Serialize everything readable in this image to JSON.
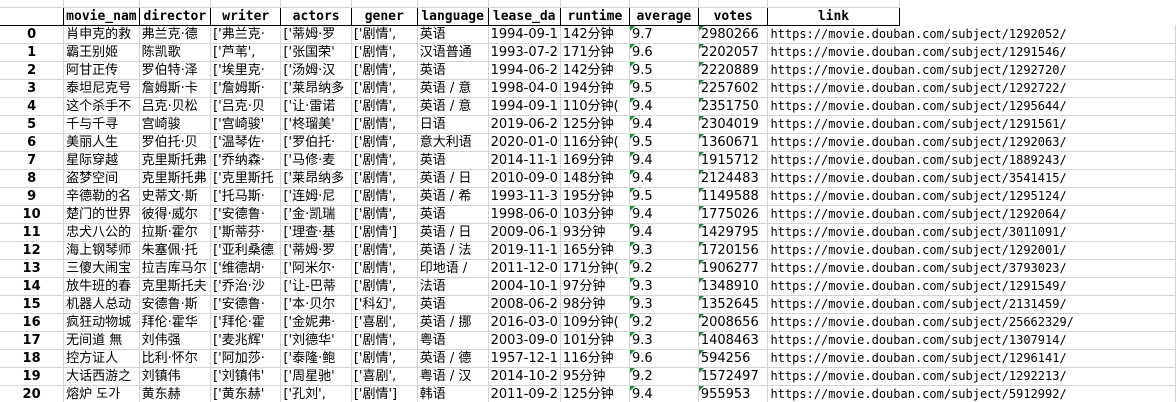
{
  "columns": [
    "",
    "movie_nam",
    "director",
    "writer",
    "actors",
    "gener",
    "language",
    "lease_da",
    "runtime",
    "average",
    "votes",
    "link"
  ],
  "rows": [
    {
      "idx": "0",
      "movie_name": "肖申克的救",
      "director": "弗兰克·德",
      "writer": "['弗兰克·",
      "actors": "['蒂姆·罗",
      "gener": "['剧情',",
      "language": "英语",
      "release": "1994-09-1",
      "runtime": "142分钟",
      "average": "9.7",
      "votes": "2980266",
      "link": "https://movie.douban.com/subject/1292052/"
    },
    {
      "idx": "1",
      "movie_name": "霸王别姬",
      "director": "陈凯歌",
      "writer": "['芦苇',",
      "actors": "['张国荣'",
      "gener": "['剧情',",
      "language": "汉语普通",
      "release": "1993-07-2",
      "runtime": "171分钟",
      "average": "9.6",
      "votes": "2202057",
      "link": "https://movie.douban.com/subject/1291546/"
    },
    {
      "idx": "2",
      "movie_name": "阿甘正传",
      "director": "罗伯特·泽",
      "writer": "['埃里克·",
      "actors": "['汤姆·汉",
      "gener": "['剧情',",
      "language": "英语",
      "release": "1994-06-2",
      "runtime": "142分钟",
      "average": "9.5",
      "votes": "2220889",
      "link": "https://movie.douban.com/subject/1292720/"
    },
    {
      "idx": "3",
      "movie_name": "泰坦尼克号",
      "director": "詹姆斯·卡",
      "writer": "['詹姆斯·",
      "actors": "['莱昂纳多",
      "gener": "['剧情',",
      "language": "英语 / 意",
      "release": "1998-04-0",
      "runtime": "194分钟",
      "average": "9.5",
      "votes": "2257602",
      "link": "https://movie.douban.com/subject/1292722/"
    },
    {
      "idx": "4",
      "movie_name": "这个杀手不",
      "director": "吕克·贝松",
      "writer": "['吕克·贝",
      "actors": "['让·雷诺",
      "gener": "['剧情',",
      "language": "英语 / 意",
      "release": "1994-09-1",
      "runtime": "110分钟(",
      "average": "9.4",
      "votes": "2351750",
      "link": "https://movie.douban.com/subject/1295644/"
    },
    {
      "idx": "5",
      "movie_name": "千与千寻",
      "director": "宫崎骏",
      "writer": "['宫崎骏'",
      "actors": "['柊瑠美'",
      "gener": "['剧情',",
      "language": "日语",
      "release": "2019-06-2",
      "runtime": "125分钟",
      "average": "9.4",
      "votes": "2304019",
      "link": "https://movie.douban.com/subject/1291561/"
    },
    {
      "idx": "6",
      "movie_name": "美丽人生",
      "director": "罗伯托·贝",
      "writer": "['温琴佐·",
      "actors": "['罗伯托·",
      "gener": "['剧情',",
      "language": "意大利语",
      "release": "2020-01-0",
      "runtime": "116分钟(",
      "average": "9.5",
      "votes": "1360671",
      "link": "https://movie.douban.com/subject/1292063/"
    },
    {
      "idx": "7",
      "movie_name": "星际穿越",
      "director": "克里斯托弗",
      "writer": "['乔纳森·",
      "actors": "['马修·麦",
      "gener": "['剧情',",
      "language": "英语",
      "release": "2014-11-1",
      "runtime": "169分钟",
      "average": "9.4",
      "votes": "1915712",
      "link": "https://movie.douban.com/subject/1889243/"
    },
    {
      "idx": "8",
      "movie_name": "盗梦空间",
      "director": "克里斯托弗",
      "writer": "['克里斯托",
      "actors": "['莱昂纳多",
      "gener": "['剧情',",
      "language": "英语 / 日",
      "release": "2010-09-0",
      "runtime": "148分钟",
      "average": "9.4",
      "votes": "2124483",
      "link": "https://movie.douban.com/subject/3541415/"
    },
    {
      "idx": "9",
      "movie_name": "辛德勒的名",
      "director": "史蒂文·斯",
      "writer": "['托马斯·",
      "actors": "['连姆·尼",
      "gener": "['剧情',",
      "language": "英语 / 希",
      "release": "1993-11-3",
      "runtime": "195分钟",
      "average": "9.5",
      "votes": "1149588",
      "link": "https://movie.douban.com/subject/1295124/"
    },
    {
      "idx": "10",
      "movie_name": "楚门的世界",
      "director": "彼得·威尔",
      "writer": "['安德鲁·",
      "actors": "['金·凯瑞",
      "gener": "['剧情',",
      "language": "英语",
      "release": "1998-06-0",
      "runtime": "103分钟",
      "average": "9.4",
      "votes": "1775026",
      "link": "https://movie.douban.com/subject/1292064/"
    },
    {
      "idx": "11",
      "movie_name": "忠犬八公的",
      "director": "拉斯·霍尔",
      "writer": "['斯蒂芬·",
      "actors": "['理查·基",
      "gener": "['剧情']",
      "language": "英语 / 日",
      "release": "2009-06-1",
      "runtime": "93分钟",
      "average": "9.4",
      "votes": "1429795",
      "link": "https://movie.douban.com/subject/3011091/"
    },
    {
      "idx": "12",
      "movie_name": "海上钢琴师",
      "director": "朱塞佩·托",
      "writer": "['亚利桑德",
      "actors": "['蒂姆·罗",
      "gener": "['剧情',",
      "language": "英语 / 法",
      "release": "2019-11-1",
      "runtime": "165分钟",
      "average": "9.3",
      "votes": "1720156",
      "link": "https://movie.douban.com/subject/1292001/"
    },
    {
      "idx": "13",
      "movie_name": "三傻大闹宝",
      "director": "拉吉库马尔",
      "writer": "['维德胡·",
      "actors": "['阿米尔·",
      "gener": "['剧情',",
      "language": "印地语 /",
      "release": "2011-12-0",
      "runtime": "171分钟(",
      "average": "9.2",
      "votes": "1906277",
      "link": "https://movie.douban.com/subject/3793023/"
    },
    {
      "idx": "14",
      "movie_name": "放牛班的春",
      "director": "克里斯托夫",
      "writer": "['乔治·沙",
      "actors": "['让-巴蒂",
      "gener": "['剧情',",
      "language": "法语",
      "release": "2004-10-1",
      "runtime": "97分钟",
      "average": "9.3",
      "votes": "1348910",
      "link": "https://movie.douban.com/subject/1291549/"
    },
    {
      "idx": "15",
      "movie_name": "机器人总动",
      "director": "安德鲁·斯",
      "writer": "['安德鲁·",
      "actors": "['本·贝尔",
      "gener": "['科幻',",
      "language": "英语",
      "release": "2008-06-2",
      "runtime": "98分钟",
      "average": "9.3",
      "votes": "1352645",
      "link": "https://movie.douban.com/subject/2131459/"
    },
    {
      "idx": "16",
      "movie_name": "疯狂动物城",
      "director": "拜伦·霍华",
      "writer": "['拜伦·霍",
      "actors": "['金妮弗·",
      "gener": "['喜剧',",
      "language": "英语 / 挪",
      "release": "2016-03-0",
      "runtime": "109分钟(",
      "average": "9.2",
      "votes": "2008656",
      "link": "https://movie.douban.com/subject/25662329/"
    },
    {
      "idx": "17",
      "movie_name": "无间道 無",
      "director": "刘伟强",
      "writer": "['麦兆辉'",
      "actors": "['刘德华'",
      "gener": "['剧情',",
      "language": "粤语",
      "release": "2003-09-0",
      "runtime": "101分钟",
      "average": "9.3",
      "votes": "1408463",
      "link": "https://movie.douban.com/subject/1307914/"
    },
    {
      "idx": "18",
      "movie_name": "控方证人",
      "director": "比利·怀尔",
      "writer": "['阿加莎·",
      "actors": "['泰隆·鲍",
      "gener": "['剧情',",
      "language": "英语 / 德",
      "release": "1957-12-1",
      "runtime": "116分钟",
      "average": "9.6",
      "votes": "594256",
      "link": "https://movie.douban.com/subject/1296141/"
    },
    {
      "idx": "19",
      "movie_name": "大话西游之",
      "director": "刘镇伟",
      "writer": "['刘镇伟'",
      "actors": "['周星驰'",
      "gener": "['喜剧',",
      "language": "粤语 / 汉",
      "release": "2014-10-2",
      "runtime": "95分钟",
      "average": "9.2",
      "votes": "1572497",
      "link": "https://movie.douban.com/subject/1292213/"
    },
    {
      "idx": "20",
      "movie_name": "熔炉 도가",
      "director": "黄东赫",
      "writer": "['黄东赫'",
      "actors": "['孔刘',",
      "gener": "['剧情']",
      "language": "韩语",
      "release": "2011-09-2",
      "runtime": "125分钟",
      "average": "9.4",
      "votes": "955953",
      "link": "https://movie.douban.com/subject/5912992/"
    }
  ]
}
